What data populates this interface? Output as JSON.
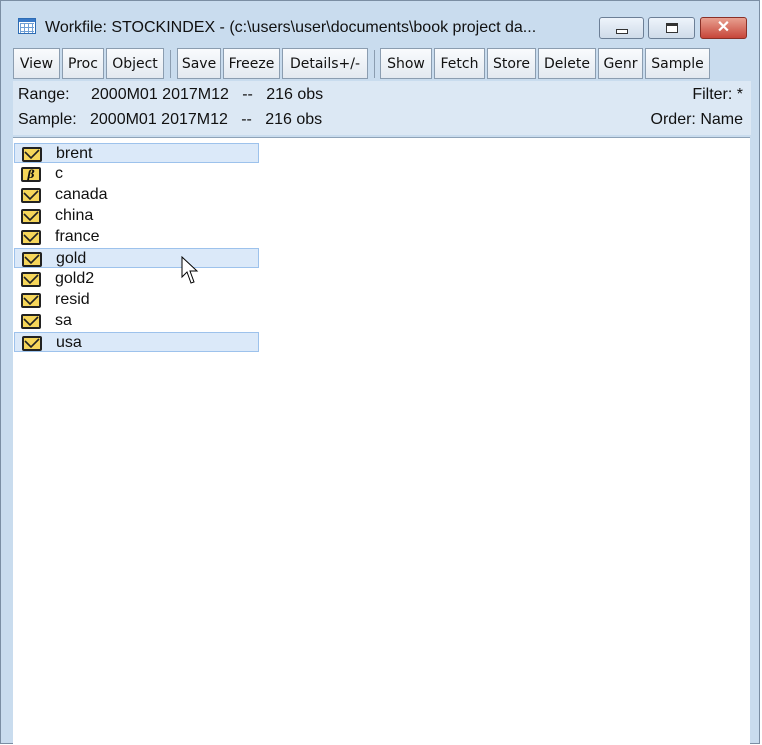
{
  "window": {
    "title": "Workfile: STOCKINDEX - (c:\\users\\user\\documents\\book project da...",
    "minimize_icon": "minimize-icon",
    "maximize_icon": "maximize-icon",
    "close_icon": "close-icon",
    "close_glyph": "✕"
  },
  "toolbar": {
    "buttons": [
      "View",
      "Proc",
      "Object",
      "Save",
      "Freeze",
      "Details+/-",
      "Show",
      "Fetch",
      "Store",
      "Delete",
      "Genr",
      "Sample"
    ]
  },
  "info": {
    "range_label": "Range:",
    "range_value": "2000M01 2017M12   --   216 obs",
    "sample_label": "Sample:",
    "sample_value": "2000M01 2017M12   --   216 obs",
    "filter": "Filter: *",
    "order": "Order: Name"
  },
  "objects": [
    {
      "name": "brent",
      "icon": "series-icon",
      "selected": true
    },
    {
      "name": "c",
      "icon": "coefficient-icon",
      "selected": false
    },
    {
      "name": "canada",
      "icon": "series-icon",
      "selected": false
    },
    {
      "name": "china",
      "icon": "series-icon",
      "selected": false
    },
    {
      "name": "france",
      "icon": "series-icon",
      "selected": false
    },
    {
      "name": "gold",
      "icon": "series-icon",
      "selected": true
    },
    {
      "name": "gold2",
      "icon": "series-icon",
      "selected": false
    },
    {
      "name": "resid",
      "icon": "series-icon",
      "selected": false
    },
    {
      "name": "sa",
      "icon": "series-icon",
      "selected": false
    },
    {
      "name": "usa",
      "icon": "series-icon",
      "selected": true
    }
  ],
  "coef_glyph": "β",
  "colors": {
    "window_frame": "#c9dcee",
    "selection": "#dbe9f9",
    "icon_fill": "#f6d65a",
    "close_button": "#c7463a"
  }
}
